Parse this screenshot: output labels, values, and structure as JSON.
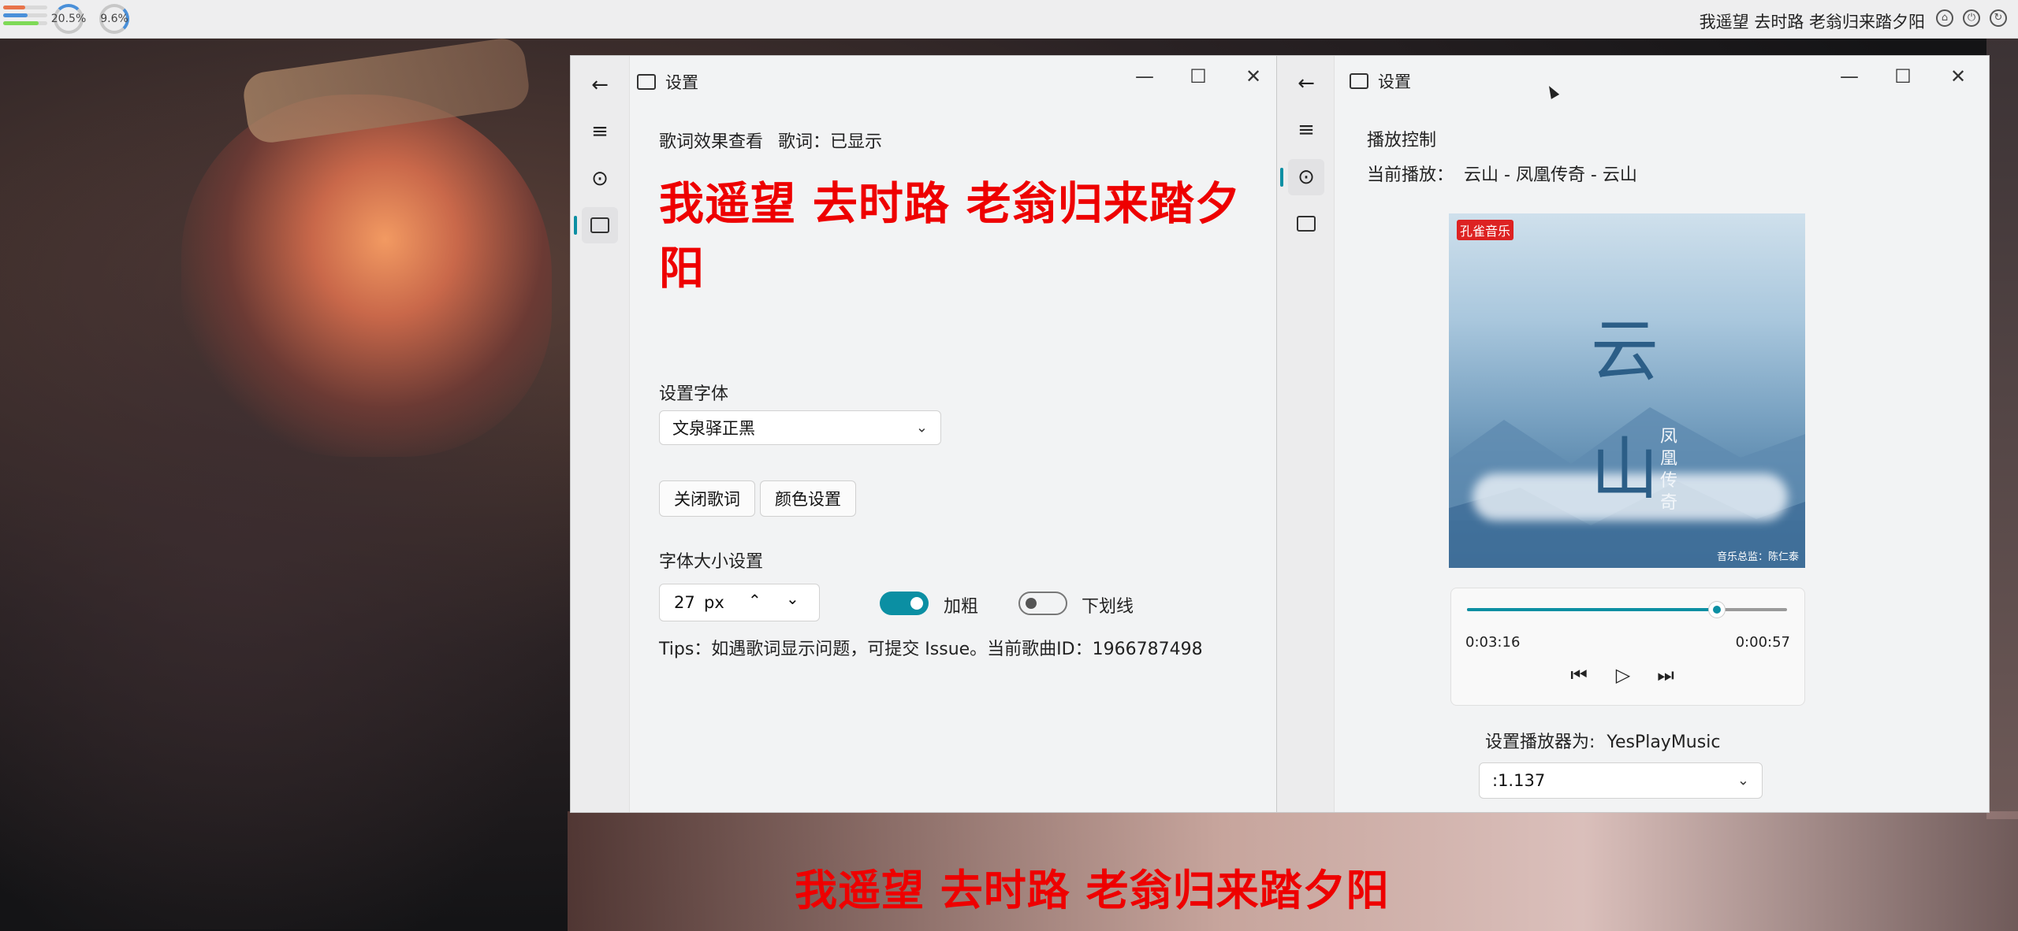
{
  "system": {
    "cpu_percent": "20.5%",
    "mem_percent": "9.6%",
    "bar_colors": [
      "#e8734a",
      "#4a90d9",
      "#7ed957"
    ],
    "bar_fill_fractions": [
      0.5,
      0.55,
      0.8
    ],
    "now_playing_text": "我遥望 去时路 老翁归来踏夕阳",
    "icons": [
      "lock-icon",
      "power-icon",
      "refresh-icon"
    ]
  },
  "left_window": {
    "title": "设置",
    "rail_icons": [
      "back-arrow-icon",
      "menu-icon",
      "play-circle-icon",
      "settings-window-icon"
    ],
    "lyric_preview_label": "歌词效果查看",
    "lyric_status": "歌词：已显示",
    "lyric_preview_text": "我遥望 去时路 老翁归来踏夕阳",
    "lyric_color": "#ee0000",
    "font_section_label": "设置字体",
    "font_selected": "文泉驿正黑",
    "close_lyric_button": "关闭歌词",
    "color_settings_button": "颜色设置",
    "font_size_label": "字体大小设置",
    "font_size_value": "27",
    "font_size_unit": "px",
    "bold_label": "加粗",
    "bold_on": true,
    "underline_label": "下划线",
    "underline_on": false,
    "tips": "Tips：如遇歌词显示问题，可提交 Issue。当前歌曲ID：1966787498"
  },
  "right_window": {
    "title": "设置",
    "section_title": "播放控制",
    "now_playing_label": "当前播放：",
    "now_playing": "云山 - 凤凰传奇 - 云山",
    "cover": {
      "logo": "孔雀音乐",
      "title_chars": "云山",
      "artist_vertical": "凤凰传奇",
      "credit": "音乐总监：陈仁泰"
    },
    "progress_fraction": 0.78,
    "time_elapsed": "0:03:16",
    "time_remaining": "0:00:57",
    "player_label": "设置播放器为:",
    "player_name": "YesPlayMusic",
    "player_selected": ":1.137"
  },
  "desktop_lyric": "我遥望 去时路 老翁归来踏夕阳"
}
